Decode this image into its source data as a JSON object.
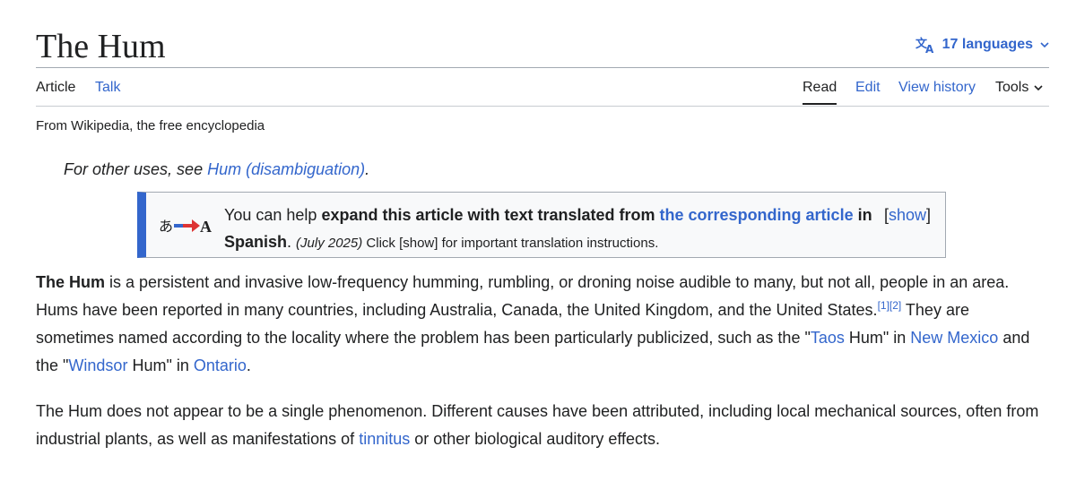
{
  "header": {
    "title": "The Hum",
    "languages_label": "17 languages"
  },
  "tabs": {
    "article": "Article",
    "talk": "Talk",
    "read": "Read",
    "edit": "Edit",
    "view_history": "View history",
    "tools": "Tools"
  },
  "tagline": "From Wikipedia, the free encyclopedia",
  "hatnote": {
    "prefix": "For other uses, see ",
    "link": "Hum (disambiguation)",
    "suffix": "."
  },
  "ambox": {
    "t1": "You can help ",
    "bold1": "expand this article with text translated from ",
    "link": "the corresponding article",
    "bold2": " in Spanish",
    "t2": ". ",
    "date": "(July 2025)",
    "t3": " Click [show] for important translation instructions.",
    "show_open": "[",
    "show": "show",
    "show_close": "]"
  },
  "para1": {
    "bold": "The Hum",
    "t1": " is a persistent and invasive low-frequency humming, rumbling, or droning noise audible to many, but not all, people in an area. Hums have been reported in many countries, including Australia, Canada, the United Kingdom, and the United States.",
    "ref1": "[1]",
    "ref2": "[2]",
    "t2": " They are sometimes named according to the locality where the problem has been particularly publicized, such as the \"",
    "link_taos": "Taos",
    "t3": " Hum\" in ",
    "link_nm": "New Mexico",
    "t4": " and the \"",
    "link_windsor": "Windsor",
    "t5": " Hum\" in ",
    "link_ontario": "Ontario",
    "t6": "."
  },
  "para2": {
    "t1": "The Hum does not appear to be a single phenomenon. Different causes have been attributed, including local mechanical sources, often from industrial plants, as well as manifestations of ",
    "link_tinnitus": "tinnitus",
    "t2": " or other biological auditory effects."
  }
}
